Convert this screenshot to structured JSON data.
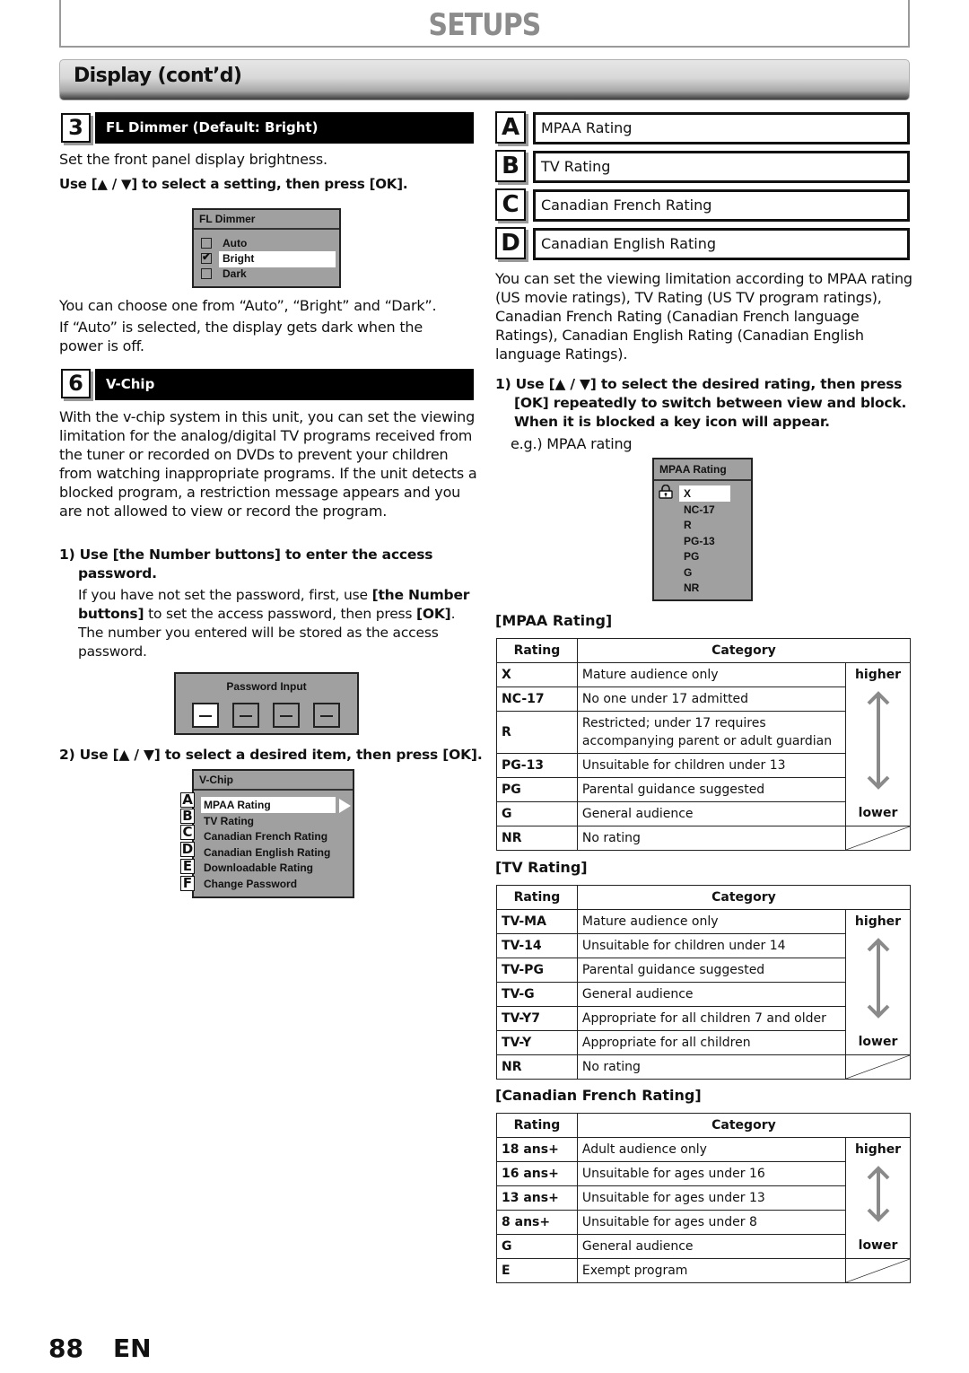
{
  "header": {
    "title": "SETUPS",
    "section": "Display (cont’d)"
  },
  "fl_dimmer": {
    "number": "3",
    "title": "FL Dimmer (Default: Bright)",
    "intro": "Set the front panel display brightness.",
    "instruction": "Use [▲ / ▼] to select a setting, then press [OK].",
    "osd": {
      "title": "FL Dimmer",
      "options": [
        {
          "label": "Auto",
          "checked": false
        },
        {
          "label": "Bright",
          "checked": true
        },
        {
          "label": "Dark",
          "checked": false
        }
      ]
    },
    "note1": "You can choose one from “Auto”, “Bright” and “Dark”.",
    "note2": "If “Auto” is selected, the display gets dark when the power is off."
  },
  "vchip": {
    "number": "6",
    "title": "V-Chip",
    "intro": "With the v-chip system in this unit, you can set the viewing limitation for the analog/digital TV programs received from the tuner or recorded on DVDs to prevent your children from watching inappropriate programs. If the unit detects a blocked program, a restriction message appears and you are not allowed to view or record the program.",
    "step1": {
      "heading": "1) Use [the Number buttons] to enter the access password.",
      "body_pre": "If you have not set the password, first, use ",
      "body_b1": "[the Number buttons]",
      "body_mid": " to set the access password, then press ",
      "body_b2": "[OK]",
      "body_post": ". The number you entered will be stored as the access password."
    },
    "password_osd": {
      "title": "Password Input",
      "slots": [
        "—",
        "—",
        "—",
        "—"
      ]
    },
    "step2": {
      "heading": "2) Use [▲ / ▼] to select a desired item, then press [OK]."
    },
    "menu_osd": {
      "title": "V-Chip",
      "items": [
        {
          "letter": "A",
          "label": "MPAA Rating"
        },
        {
          "letter": "B",
          "label": "TV Rating"
        },
        {
          "letter": "C",
          "label": "Canadian French Rating"
        },
        {
          "letter": "D",
          "label": "Canadian English Rating"
        },
        {
          "letter": "E",
          "label": "Downloadable Rating"
        },
        {
          "letter": "F",
          "label": "Change Password"
        }
      ]
    }
  },
  "right": {
    "items": [
      {
        "letter": "A",
        "label": "MPAA Rating"
      },
      {
        "letter": "B",
        "label": "TV Rating"
      },
      {
        "letter": "C",
        "label": "Canadian French Rating"
      },
      {
        "letter": "D",
        "label": "Canadian English Rating"
      }
    ],
    "intro": "You can set the viewing limitation according to MPAA rating (US movie ratings), TV Rating (US TV program ratings), Canadian French Rating (Canadian French language Ratings), Canadian English Rating (Canadian English language Ratings).",
    "step1": {
      "line1": "1) Use [▲ / ▼] to select the desired rating, then press",
      "line2": "[OK] repeatedly to switch between view and block.",
      "line3": "When it is blocked a key icon will appear."
    },
    "eg": "e.g.) MPAA rating",
    "mpaa_osd": {
      "title": "MPAA Rating",
      "items": [
        "X",
        "NC-17",
        "R",
        "PG-13",
        "PG",
        "G",
        "NR"
      ],
      "locked": "X"
    }
  },
  "tables": {
    "col_rating": "Rating",
    "col_category": "Category",
    "higher": "higher",
    "lower": "lower",
    "mpaa": {
      "title": "[MPAA Rating]",
      "rows": [
        {
          "rating": "X",
          "category": "Mature audience only"
        },
        {
          "rating": "NC-17",
          "category": "No one under 17 admitted"
        },
        {
          "rating": "R",
          "category": "Restricted; under 17 requires accompanying parent or adult guardian"
        },
        {
          "rating": "PG-13",
          "category": "Unsuitable for children under 13"
        },
        {
          "rating": "PG",
          "category": "Parental guidance suggested"
        },
        {
          "rating": "G",
          "category": "General audience"
        },
        {
          "rating": "NR",
          "category": "No rating"
        }
      ]
    },
    "tv": {
      "title": "[TV Rating]",
      "rows": [
        {
          "rating": "TV-MA",
          "category": "Mature audience only"
        },
        {
          "rating": "TV-14",
          "category": "Unsuitable for children under 14"
        },
        {
          "rating": "TV-PG",
          "category": "Parental guidance suggested"
        },
        {
          "rating": "TV-G",
          "category": "General audience"
        },
        {
          "rating": "TV-Y7",
          "category": "Appropriate for all children 7 and older"
        },
        {
          "rating": "TV-Y",
          "category": "Appropriate for all children"
        },
        {
          "rating": "NR",
          "category": "No rating"
        }
      ]
    },
    "cfr": {
      "title": "[Canadian French Rating]",
      "rows": [
        {
          "rating": "18 ans+",
          "category": "Adult audience only"
        },
        {
          "rating": "16 ans+",
          "category": "Unsuitable for ages under 16"
        },
        {
          "rating": "13 ans+",
          "category": "Unsuitable for ages under 13"
        },
        {
          "rating": "8 ans+",
          "category": "Unsuitable for ages under 8"
        },
        {
          "rating": "G",
          "category": "General audience"
        },
        {
          "rating": "E",
          "category": "Exempt program"
        }
      ]
    }
  },
  "footer": {
    "page": "88",
    "lang": "EN"
  }
}
